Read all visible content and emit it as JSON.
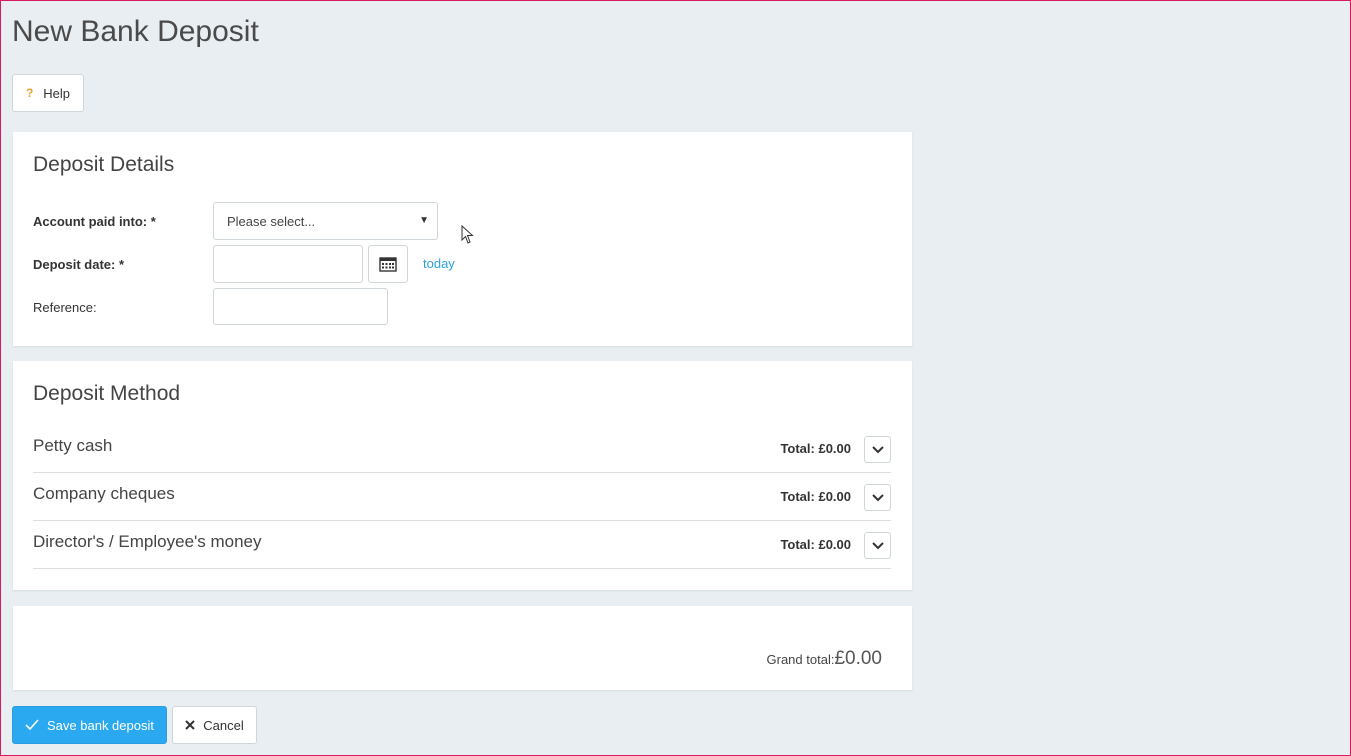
{
  "page": {
    "title": "New Bank Deposit"
  },
  "toolbar": {
    "help_label": "Help",
    "help_icon": "?"
  },
  "deposit_details": {
    "heading": "Deposit Details",
    "account_label": "Account paid into: *",
    "account_value": "Please select...",
    "date_label": "Deposit date: *",
    "date_value": "",
    "today_link": "today",
    "reference_label": "Reference:",
    "reference_value": ""
  },
  "deposit_method": {
    "heading": "Deposit Method",
    "rows": [
      {
        "label": "Petty cash",
        "total": "Total: £0.00"
      },
      {
        "label": "Company cheques",
        "total": "Total: £0.00"
      },
      {
        "label": "Director's / Employee's money",
        "total": "Total: £0.00"
      }
    ]
  },
  "summary": {
    "grand_total_label": "Grand total:",
    "grand_total_value": "£0.00"
  },
  "actions": {
    "save_label": "Save bank deposit",
    "cancel_label": "Cancel"
  },
  "colors": {
    "accent": "#2aa8f0",
    "link": "#2aa3d8",
    "background": "#e8eef1",
    "frame": "#d81b60"
  },
  "icons": {
    "help": "question-icon",
    "calendar": "calendar-icon",
    "expand": "chevron-down-icon",
    "save": "check-icon",
    "cancel": "close-icon"
  }
}
